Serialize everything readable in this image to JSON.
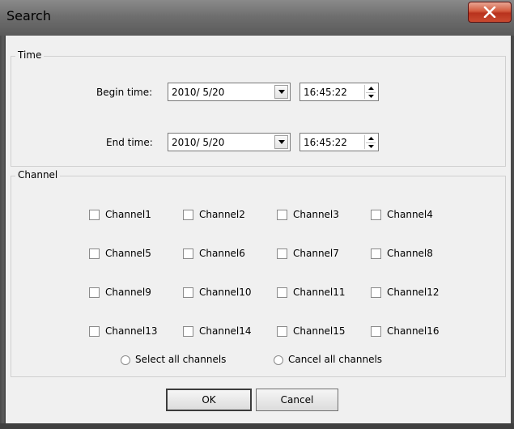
{
  "window": {
    "title": "Search"
  },
  "time_group": {
    "label": "Time",
    "begin": {
      "label": "Begin time:",
      "date": "2010/ 5/20",
      "time": "16:45:22"
    },
    "end": {
      "label": "End time:",
      "date": "2010/ 5/20",
      "time": "16:45:22"
    }
  },
  "channel_group": {
    "label": "Channel",
    "channels": [
      "Channel1",
      "Channel2",
      "Channel3",
      "Channel4",
      "Channel5",
      "Channel6",
      "Channel7",
      "Channel8",
      "Channel9",
      "Channel10",
      "Channel11",
      "Channel12",
      "Channel13",
      "Channel14",
      "Channel15",
      "Channel16"
    ],
    "select_all": "Select all channels",
    "cancel_all": "Cancel all channels"
  },
  "buttons": {
    "ok": "OK",
    "cancel": "Cancel"
  },
  "icons": {
    "close": "close-icon",
    "dropdown": "chevron-down-icon",
    "spin": "spin-arrows-icon"
  }
}
